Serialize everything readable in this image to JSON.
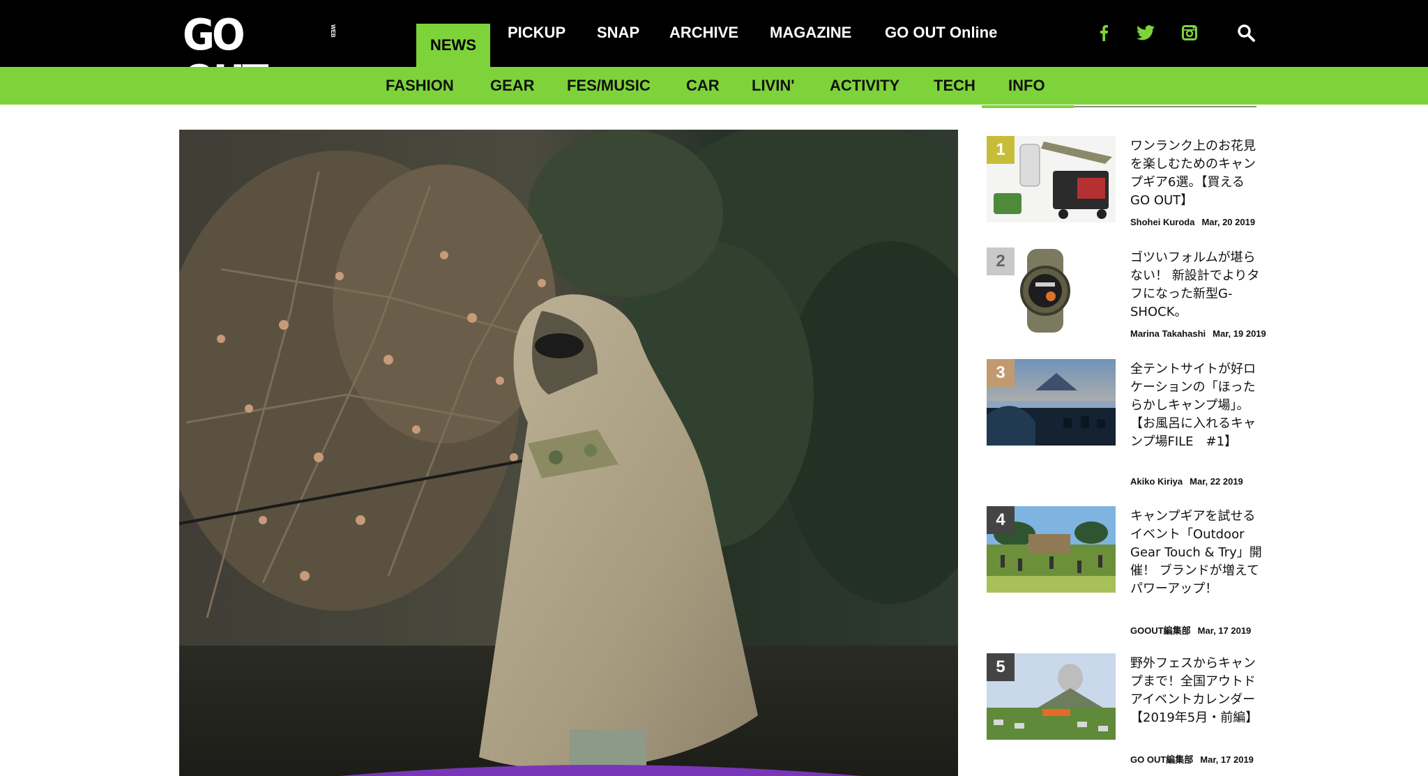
{
  "header": {
    "logo_text": "GO OUT",
    "logo_sub": "WEB",
    "main_nav": [
      {
        "label": "NEWS",
        "active": true
      },
      {
        "label": "PICKUP"
      },
      {
        "label": "SNAP"
      },
      {
        "label": "ARCHIVE"
      },
      {
        "label": "MAGAZINE"
      },
      {
        "label": "GO OUT Online"
      }
    ],
    "social_icons": [
      "facebook-icon",
      "twitter-icon",
      "instagram-icon"
    ],
    "search_icon": "search-icon",
    "sub_nav": [
      "FASHION",
      "GEAR",
      "FES/MUSIC",
      "CAR",
      "LIVIN'",
      "ACTIVITY",
      "TECH",
      "INFO"
    ]
  },
  "colors": {
    "accent": "#7ed33b",
    "topbar": "#000000",
    "rank1": "#c7bd3a",
    "rank2": "#c9c9c9",
    "rank3": "#c29a6f",
    "rank4": "#444444",
    "rank5": "#444444"
  },
  "hero": {
    "image": "photo of man in beige rain poncho fishing by a river"
  },
  "ranking": [
    {
      "rank": "1",
      "title": "ワンランク上のお花見を楽しむためのキャンプギア6選。【買えるGO OUT】",
      "author": "Shohei Kuroda",
      "date": "Mar, 20 2019"
    },
    {
      "rank": "2",
      "title": "ゴツいフォルムが堪らない！ 新設計でよりタフになった新型G-SHOCK。",
      "author": "Marina Takahashi",
      "date": "Mar, 19 2019"
    },
    {
      "rank": "3",
      "title": "全テントサイトが好ロケーションの「ほったらかしキャンプ場」。【お風呂に入れるキャンプ場FILE　#1】",
      "author": "Akiko Kiriya",
      "date": "Mar, 22 2019"
    },
    {
      "rank": "4",
      "title": "キャンプギアを試せるイベント「Outdoor Gear Touch & Try」開催！ ブランドが増えてパワーアップ！",
      "author": "GOOUT編集部",
      "date": "Mar, 17 2019"
    },
    {
      "rank": "5",
      "title": "野外フェスからキャンプまで！全国アウトドアイベントカレンダー【2019年5月・前編】",
      "author": "GO OUT編集部",
      "date": "Mar, 17 2019"
    }
  ]
}
